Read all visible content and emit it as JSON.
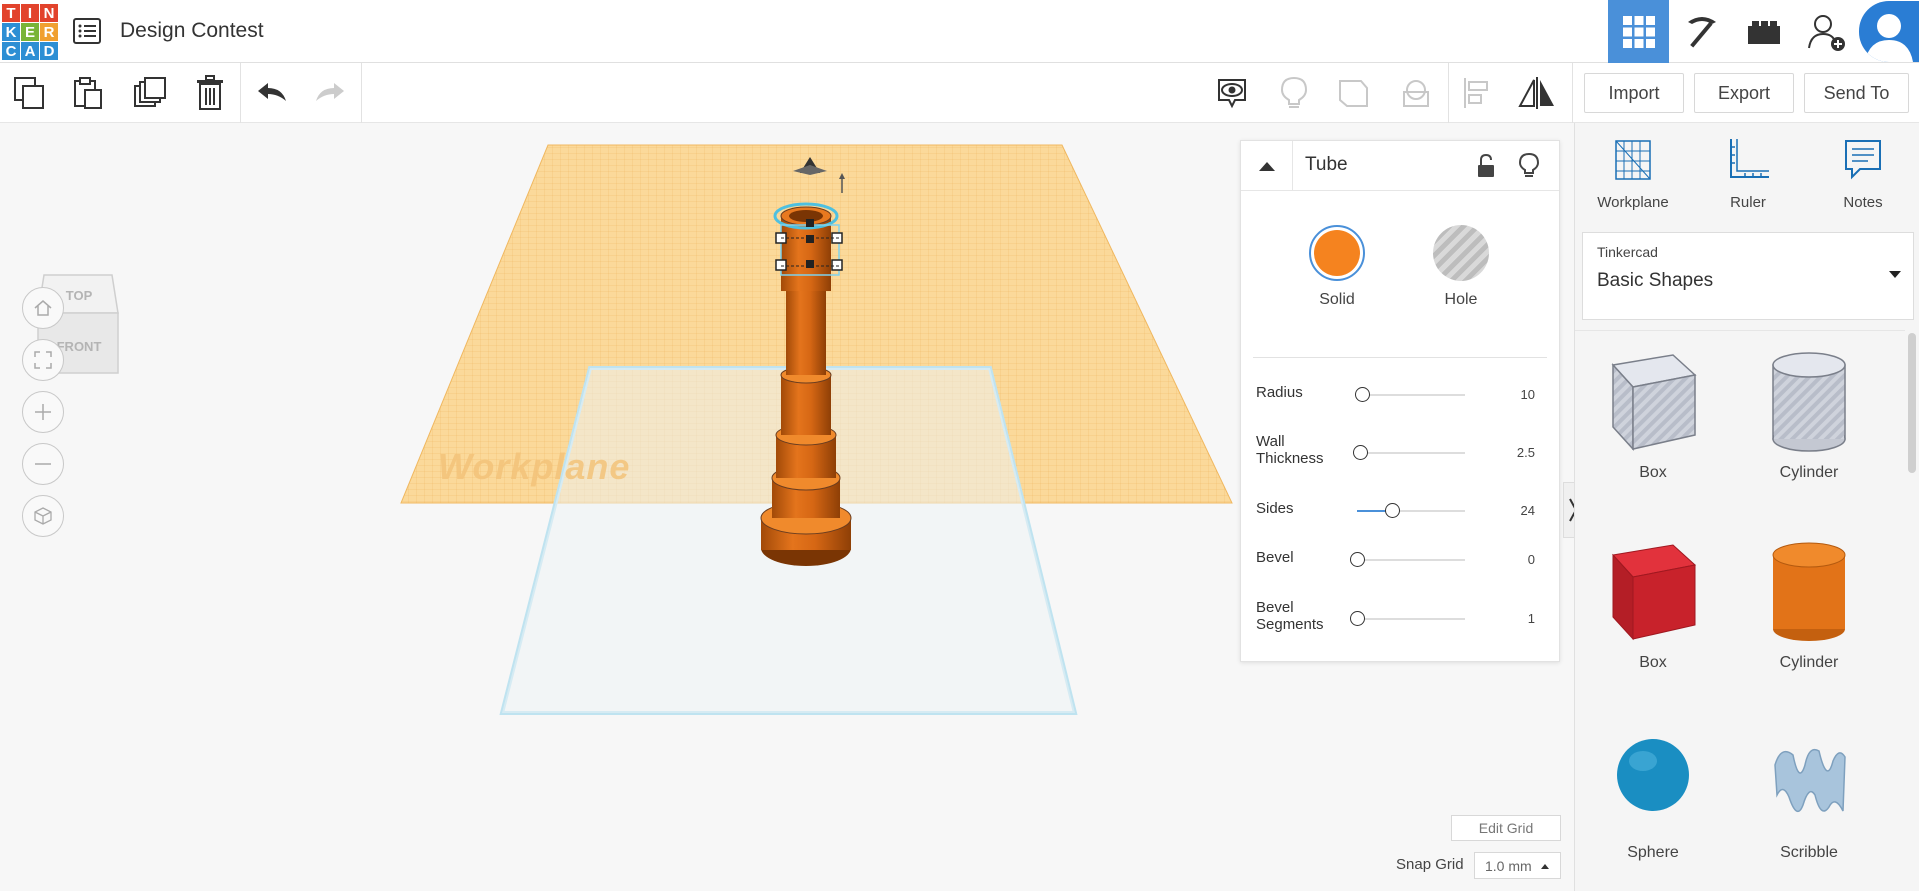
{
  "app": {
    "logo_letters": [
      "T",
      "I",
      "N",
      "K",
      "E",
      "R",
      "C",
      "A",
      "D"
    ],
    "logo_colors": [
      "#e2432c",
      "#e2432c",
      "#e2432c",
      "#2d8fd4",
      "#79b437",
      "#f0a030",
      "#2d8fd4",
      "#2d8fd4",
      "#2d8fd4"
    ],
    "design_title": "Design Contest"
  },
  "topbar": {
    "icons": {
      "design_list": "list-icon",
      "view_3d": "grid-icon",
      "view_build": "pickaxe-icon",
      "view_lego": "brick-icon",
      "invite": "add-user-icon",
      "avatar": "user-avatar-icon"
    },
    "accent_color": "#4a90d9"
  },
  "toolbar": {
    "icons": [
      "copy-icon",
      "paste-icon",
      "duplicate-icon",
      "trash-icon",
      "undo-icon",
      "redo-icon",
      "show-hide-icon",
      "light-bulb-icon",
      "group-icon",
      "ungroup-icon",
      "align-icon",
      "mirror-icon"
    ],
    "import_label": "Import",
    "export_label": "Export",
    "send_to_label": "Send To"
  },
  "canvas": {
    "view_cube_top": "TOP",
    "view_cube_front": "FRONT",
    "workplane_label": "Workplane",
    "nav_icons": [
      "home-icon",
      "fit-view-icon",
      "zoom-in-icon",
      "zoom-out-icon",
      "perspective-icon"
    ],
    "edit_grid_label": "Edit Grid",
    "snap_grid_label": "Snap Grid",
    "snap_grid_value": "1.0 mm"
  },
  "inspector": {
    "title": "Tube",
    "solid_label": "Solid",
    "hole_label": "Hole",
    "solid_color": "#f5831f",
    "properties": [
      {
        "label": "Radius",
        "value": "10",
        "fraction": 0.05
      },
      {
        "label": "Wall Thickness",
        "value": "2.5",
        "fraction": 0.03
      },
      {
        "label": "Sides",
        "value": "24",
        "fraction": 0.32
      },
      {
        "label": "Bevel",
        "value": "0",
        "fraction": 0.0
      },
      {
        "label": "Bevel Segments",
        "value": "1",
        "fraction": 0.0
      }
    ]
  },
  "sidebar": {
    "tools": [
      {
        "label": "Workplane",
        "icon": "workplane-icon"
      },
      {
        "label": "Ruler",
        "icon": "ruler-icon"
      },
      {
        "label": "Notes",
        "icon": "notes-icon"
      }
    ],
    "library_owner": "Tinkercad",
    "library_name": "Basic Shapes",
    "shapes": [
      {
        "label": "Box"
      },
      {
        "label": "Cylinder"
      },
      {
        "label": "Box"
      },
      {
        "label": "Cylinder"
      },
      {
        "label": "Sphere"
      },
      {
        "label": "Scribble"
      }
    ]
  }
}
